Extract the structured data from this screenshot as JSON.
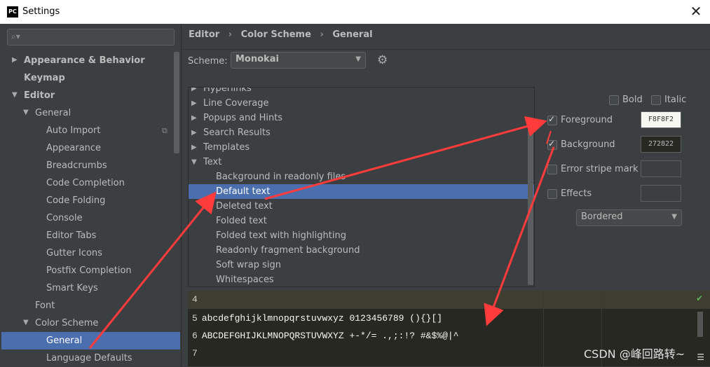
{
  "window": {
    "title": "Settings",
    "logo_text": "PC"
  },
  "search": {
    "placeholder": ""
  },
  "sidebar": {
    "items": [
      {
        "label": "Appearance & Behavior"
      },
      {
        "label": "Keymap"
      },
      {
        "label": "Editor"
      },
      {
        "label": "General"
      },
      {
        "label": "Auto Import"
      },
      {
        "label": "Appearance"
      },
      {
        "label": "Breadcrumbs"
      },
      {
        "label": "Code Completion"
      },
      {
        "label": "Code Folding"
      },
      {
        "label": "Console"
      },
      {
        "label": "Editor Tabs"
      },
      {
        "label": "Gutter Icons"
      },
      {
        "label": "Postfix Completion"
      },
      {
        "label": "Smart Keys"
      },
      {
        "label": "Font"
      },
      {
        "label": "Color Scheme"
      },
      {
        "label": "General"
      },
      {
        "label": "Language Defaults"
      }
    ]
  },
  "breadcrumb": {
    "parts": [
      "Editor",
      "Color Scheme",
      "General"
    ],
    "separator": "›"
  },
  "scheme": {
    "label": "Scheme:",
    "value": "Monokai"
  },
  "list": {
    "items": [
      {
        "label": "Hyperlinks"
      },
      {
        "label": "Line Coverage"
      },
      {
        "label": "Popups and Hints"
      },
      {
        "label": "Search Results"
      },
      {
        "label": "Templates"
      },
      {
        "label": "Text"
      },
      {
        "label": "Background in readonly files"
      },
      {
        "label": "Default text"
      },
      {
        "label": "Deleted text"
      },
      {
        "label": "Folded text"
      },
      {
        "label": "Folded text with highlighting"
      },
      {
        "label": "Readonly fragment background"
      },
      {
        "label": "Soft wrap sign"
      },
      {
        "label": "Whitespaces"
      }
    ]
  },
  "options": {
    "bold": "Bold",
    "italic": "Italic",
    "foreground": {
      "label": "Foreground",
      "value": "F8F8F2",
      "checked": true
    },
    "background": {
      "label": "Background",
      "value": "272822",
      "checked": true
    },
    "error_stripe": {
      "label": "Error stripe mark",
      "checked": false
    },
    "effects": {
      "label": "Effects",
      "checked": false
    },
    "effect_type": "Bordered"
  },
  "preview": {
    "lines": [
      {
        "num": "4",
        "text": ""
      },
      {
        "num": "5",
        "text": "abcdefghijklmnopqrstuvwxyz 0123456789 (){}[]"
      },
      {
        "num": "6",
        "text": "ABCDEFGHIJKLMNOPQRSTUVWXYZ +-*/= .,;:!? #&$%@|^"
      },
      {
        "num": "7",
        "text": ""
      }
    ]
  },
  "watermark": "CSDN @峰回路转~",
  "colors": {
    "accent": "#4b6eaf",
    "annotation": "#ff3b3b",
    "editor_bg": "#272822",
    "editor_fg": "#F8F8F2"
  }
}
